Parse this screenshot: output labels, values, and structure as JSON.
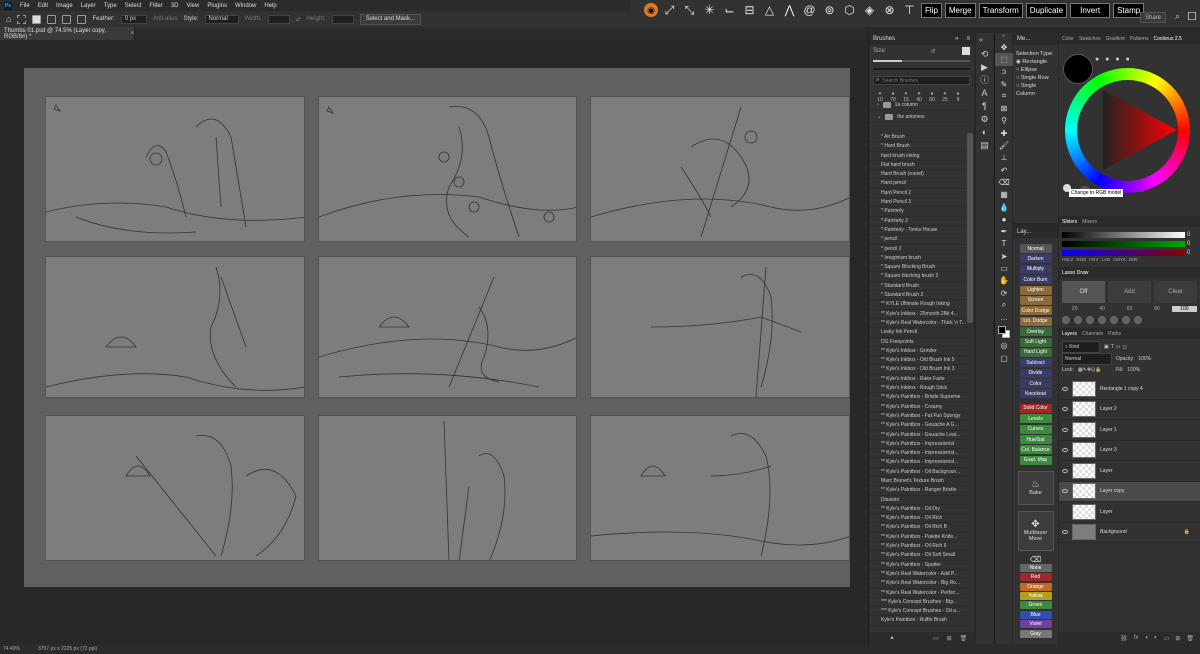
{
  "menu": {
    "items": [
      "File",
      "Edit",
      "Image",
      "Layer",
      "Type",
      "Select",
      "Filter",
      "3D",
      "View",
      "Plugins",
      "Window",
      "Help"
    ]
  },
  "options": {
    "feather_label": "Feather:",
    "feather_value": "0 px",
    "antialias_label": "Anti-alias",
    "style_label": "Style:",
    "style_value": "Normal",
    "width_label": "Width:",
    "height_label": "Height:",
    "select_mask_label": "Select and Mask..."
  },
  "script_toolbar": {
    "icons": [
      "orange-circle-icon",
      "scatter-icon",
      "path-icon",
      "starburst-icon",
      "corner-icon",
      "stack-icon",
      "triangle-icon",
      "mountain-icon",
      "spiral-icon",
      "spiral-icon",
      "cube-icon",
      "circle-diamond-icon",
      "circle-x-icon",
      "tee-icon"
    ],
    "buttons": [
      "Flip",
      "Merge",
      "Transform",
      "Duplicate",
      "Invert",
      "Stamp"
    ]
  },
  "share_label": "Share",
  "document": {
    "tab_title": "Thumbs 01.psd @ 74.5% (Layer copy, RGB/8#) *"
  },
  "status": {
    "zoom": "74.49%",
    "info": "3757 px x 2225 px (72 ppi)"
  },
  "brushes": {
    "title": "Brushes",
    "size_label": "Size:",
    "search_placeholder": "Search Brushes",
    "preset_sizes": [
      "10",
      "70",
      "15",
      "40",
      "60",
      "25",
      "9"
    ],
    "folders": [
      "1a column",
      "the antonios"
    ],
    "items": [
      "* Air Brush",
      "* Hard Brush",
      "hard brush inking",
      "Flat hard brush",
      "Hard Brush (round)",
      "Hard pencil",
      "Hard Pencil 2",
      "Hard Pencil 3",
      "* Painterly",
      "* Painterly 2",
      "* Painterly - Tonko House",
      "* pencil",
      "* pencil 2",
      "* Imaginism brush",
      "* Square Blocking Brush",
      "* Square blocking brush 2",
      "* Standard Brush",
      "* Standard Brush 2",
      "** KYLE Ultimate Rough Inking",
      "** Kyle's Inkbox - 25mooth 2Bit 4...",
      "** Kyle's Real Watercolor - Thick 'n T...",
      "Lesky Ink Pencil",
      "DG Freepoints",
      "** Kyle's Inkbox - Grinder",
      "** Kyle's Inkbox - Old Brush Ink 5",
      "** Kyle's Inkbox - Old Brush Ink 3",
      "** Kyle's Inkbox - Rake Fade",
      "** Kyle's Inkbox - Rough Stick",
      "** Kyle's Paintbox - Bristle Supreme",
      "** Kyle's Paintbox - Creamy",
      "** Kyle's Paintbox - Fat Fun Spongy",
      "** Kyle's Paintbox - Gouache A G...",
      "** Kyle's Paintbox - Gouache Leat...",
      "** Kyle's Paintbox - Impressionist",
      "** Kyle's Paintbox - Impressionist...",
      "** Kyle's Paintbox - Impressionist...",
      "** Kyle's Paintbox - Oil Backgroun...",
      "Marc Brunet's Texture Brush",
      "** Kyle's Paintbox - Ranger Bristle",
      "Disastro",
      "** Kyle's Paintbox - Oil Dry",
      "** Kyle's Paintbox - Oil Rich",
      "** Kyle's Paintbox - Oil Rich B",
      "** Kyle's Paintbox - Palette Knife...",
      "** Kyle's Paintbox - Oil Rich II",
      "** Kyle's Paintbox - Oil Soft Small",
      "** Kyle's Paintbox - Spatter",
      "** Kyle's Real Watercolor - Add P...",
      "** Kyle's Real Watercolor - Big Ro...",
      "** Kyle's Real Watercolor - Perfec...",
      "*** Kyle's Concept Brushes - Big...",
      "*** Kyle's Concept Brushes - Oil a...",
      "Kyle's Paintbox - Ruffin Brush"
    ]
  },
  "selection_panel": {
    "title": "Me...",
    "label": "Selection Type:",
    "options": [
      "Rectangle",
      "Ellipse",
      "Single Row",
      "Single Column"
    ]
  },
  "blend_panel": {
    "title": "Lay...",
    "modes": [
      "Normal",
      "Darken",
      "Multiply",
      "Color Burn",
      "Lighten",
      "Screen",
      "Color Dodge",
      "Lin. Dodge",
      "Overlay",
      "Soft Light",
      "Hard Light",
      "Subtract",
      "Divide",
      "Color",
      "Knockout"
    ],
    "adjustments": [
      "Solid Color",
      "Levels",
      "Curves",
      "Hue/Sat",
      "Col. Balance",
      "Grad. Map"
    ],
    "bake_label": "Bake",
    "multilayer_label": "Multilayer Move",
    "colors": [
      "None",
      "Red",
      "Orange",
      "Yellow",
      "Green",
      "Blue",
      "Violet",
      "Gray"
    ]
  },
  "color_tabs": [
    "Color",
    "Swatches",
    "Gradient",
    "Patterns",
    "Coolorus 2.5"
  ],
  "tooltip": "Change to RGB model",
  "sliders": {
    "tabs": [
      "Sliders",
      "Mixers"
    ],
    "values": [
      "0",
      "0",
      "0"
    ],
    "modes": [
      "HSLV",
      "RGB",
      "HSV",
      "LAB",
      "CMYK",
      "B/W"
    ]
  },
  "lasso": {
    "title": "Lasso Draw",
    "buttons": [
      "Off",
      "Add",
      "Clear"
    ],
    "values": [
      "20",
      "40",
      "60",
      "80",
      "100"
    ]
  },
  "layers": {
    "tabs": [
      "Layers",
      "Channels",
      "Paths"
    ],
    "kind_label": "Kind",
    "blend": "Normal",
    "opacity_label": "Opacity:",
    "opacity": "100%",
    "lock_label": "Lock:",
    "fill_label": "Fill:",
    "fill": "100%",
    "rows": [
      "Rectangle 1 copy 4",
      "Layer 2",
      "Layer 1",
      "Layer 3",
      "Layer",
      "Layer copy",
      "Layer",
      "Background"
    ]
  }
}
